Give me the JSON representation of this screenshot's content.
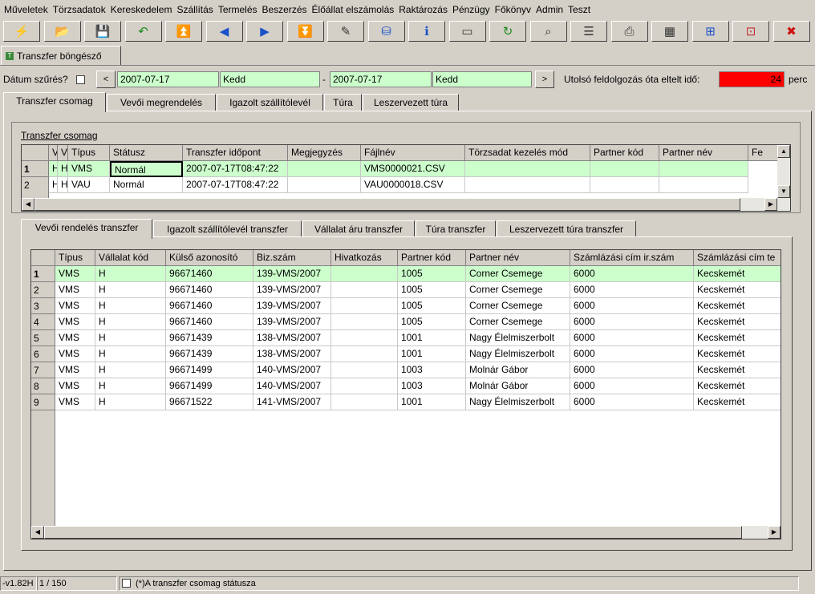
{
  "menu": [
    "Műveletek",
    "Törzsadatok",
    "Kereskedelem",
    "Szállítás",
    "Termelés",
    "Beszerzés",
    "Élőállat elszámolás",
    "Raktározás",
    "Pénzügy",
    "Főkönyv",
    "Admin",
    "Teszt"
  ],
  "toolbar_icons": [
    "lightning-icon",
    "open-folder-icon",
    "save-icon",
    "undo-icon",
    "first-record-icon",
    "prev-record-icon",
    "next-record-icon",
    "last-record-icon",
    "edit-icon",
    "database-icon",
    "info-icon",
    "form-icon",
    "refresh-icon",
    "search-icon",
    "table-rows-icon",
    "print-icon",
    "grid-icon",
    "export-grid-icon",
    "filter-icon",
    "close-icon"
  ],
  "window_tab": "Transzfer böngésző",
  "filter": {
    "label": "Dátum szűrés?",
    "date_from": "2007-07-17",
    "day_from": "Kedd",
    "date_to": "2007-07-17",
    "day_to": "Kedd",
    "elapsed_label": "Utolsó feldolgozás óta eltelt idő:",
    "elapsed_value": "24",
    "elapsed_unit": "perc",
    "prev_label": "<",
    "next_label": ">",
    "dash": "-"
  },
  "top_tabs": [
    "Transzfer csomag",
    "Vevői megrendelés",
    "Igazolt szállítólevél",
    "Túra",
    "Leszervezett túra"
  ],
  "package": {
    "title": "Transzfer csomag",
    "columns": [
      "Va",
      "V",
      "Típus",
      "Státusz",
      "Transzfer időpont",
      "Megjegyzés",
      "Fájlnév",
      "Törzsadat kezelés mód",
      "Partner kód",
      "Partner név",
      "Fe"
    ],
    "rows": [
      [
        "1",
        "H",
        "H",
        "VMS",
        "Normál",
        "2007-07-17T08:47:22",
        "",
        "VMS0000021.CSV",
        "",
        "",
        ""
      ],
      [
        "2",
        "H",
        "H",
        "VAU",
        "Normál",
        "2007-07-17T08:47:22",
        "",
        "VAU0000018.CSV",
        "",
        "",
        ""
      ]
    ]
  },
  "sub_tabs": [
    "Vevői rendelés transzfer",
    "Igazolt szállítólevél transzfer",
    "Vállalat áru transzfer",
    "Túra transzfer",
    "Leszervezett túra transzfer"
  ],
  "orders": {
    "columns": [
      "Típus",
      "Vállalat kód",
      "Külső azonosító",
      "Biz.szám",
      "Hivatkozás",
      "Partner kód",
      "Partner név",
      "Számlázási cím ir.szám",
      "Számlázási cím te"
    ],
    "rows": [
      [
        "1",
        "VMS",
        "H",
        "96671460",
        "139-VMS/2007",
        "",
        "1005",
        "Corner Csemege",
        "6000",
        "Kecskemét"
      ],
      [
        "2",
        "VMS",
        "H",
        "96671460",
        "139-VMS/2007",
        "",
        "1005",
        "Corner Csemege",
        "6000",
        "Kecskemét"
      ],
      [
        "3",
        "VMS",
        "H",
        "96671460",
        "139-VMS/2007",
        "",
        "1005",
        "Corner Csemege",
        "6000",
        "Kecskemét"
      ],
      [
        "4",
        "VMS",
        "H",
        "96671460",
        "139-VMS/2007",
        "",
        "1005",
        "Corner Csemege",
        "6000",
        "Kecskemét"
      ],
      [
        "5",
        "VMS",
        "H",
        "96671439",
        "138-VMS/2007",
        "",
        "1001",
        "Nagy Élelmiszerbolt",
        "6000",
        "Kecskemét"
      ],
      [
        "6",
        "VMS",
        "H",
        "96671439",
        "138-VMS/2007",
        "",
        "1001",
        "Nagy Élelmiszerbolt",
        "6000",
        "Kecskemét"
      ],
      [
        "7",
        "VMS",
        "H",
        "96671499",
        "140-VMS/2007",
        "",
        "1003",
        "Molnár Gábor",
        "6000",
        "Kecskemét"
      ],
      [
        "8",
        "VMS",
        "H",
        "96671499",
        "140-VMS/2007",
        "",
        "1003",
        "Molnár Gábor",
        "6000",
        "Kecskemét"
      ],
      [
        "9",
        "VMS",
        "H",
        "96671522",
        "141-VMS/2007",
        "",
        "1001",
        "Nagy Élelmiszerbolt",
        "6000",
        "Kecskemét"
      ]
    ]
  },
  "status": {
    "version": "-v1.82H",
    "record": "1 / 150",
    "message": "(*)A transzfer csomag státusza"
  },
  "colors": {
    "selected_row": "#ccffcc",
    "field_green": "#ccffcc",
    "elapsed_red": "#ff0000"
  }
}
